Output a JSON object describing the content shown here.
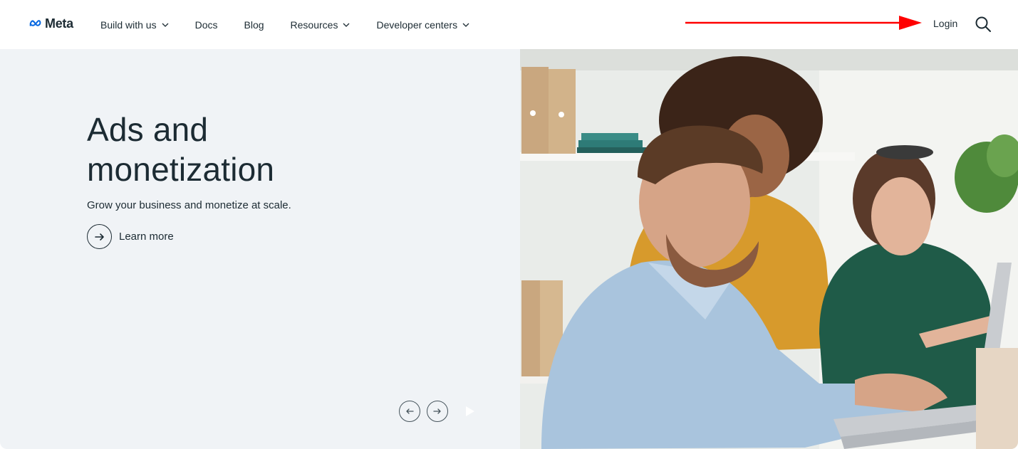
{
  "header": {
    "brand": "Meta",
    "nav": [
      {
        "label": "Build with us",
        "has_dropdown": true
      },
      {
        "label": "Docs",
        "has_dropdown": false
      },
      {
        "label": "Blog",
        "has_dropdown": false
      },
      {
        "label": "Resources",
        "has_dropdown": true
      },
      {
        "label": "Developer centers",
        "has_dropdown": true
      }
    ],
    "login": "Login",
    "search_icon": "search-icon",
    "annotation_color": "#ff0000"
  },
  "hero": {
    "title_line1": "Ads and",
    "title_line2": "monetization",
    "subtitle": "Grow your business and monetize at scale.",
    "cta": "Learn more",
    "photo": "Three colleagues working together at a laptop in an office"
  },
  "colors": {
    "text": "#1c2b33",
    "hero_bg": "#f0f3f6",
    "meta_blue": "#0668e1"
  }
}
